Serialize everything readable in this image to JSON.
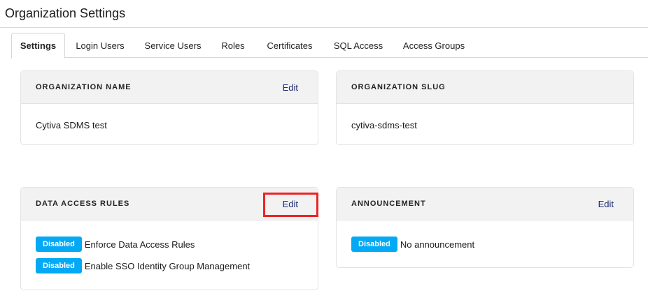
{
  "page": {
    "title": "Organization Settings"
  },
  "tabs": [
    {
      "label": "Settings",
      "active": true
    },
    {
      "label": "Login Users"
    },
    {
      "label": "Service Users"
    },
    {
      "label": "Roles"
    },
    {
      "label": "Certificates"
    },
    {
      "label": "SQL Access"
    },
    {
      "label": "Access Groups"
    }
  ],
  "cards": {
    "org_name": {
      "title": "ORGANIZATION NAME",
      "edit_label": "Edit",
      "value": "Cytiva SDMS test"
    },
    "org_slug": {
      "title": "ORGANIZATION SLUG",
      "value": "cytiva-sdms-test"
    },
    "data_access_rules": {
      "title": "DATA ACCESS RULES",
      "edit_label": "Edit",
      "rules": [
        {
          "status": "Disabled",
          "label": "Enforce Data Access Rules"
        },
        {
          "status": "Disabled",
          "label": "Enable SSO Identity Group Management"
        }
      ]
    },
    "announcement": {
      "title": "ANNOUNCEMENT",
      "edit_label": "Edit",
      "status": "Disabled",
      "label": "No announcement"
    }
  },
  "colors": {
    "badge": "#03a9f4",
    "edit_link": "#1c2a6e",
    "highlight": "#ee2222"
  }
}
